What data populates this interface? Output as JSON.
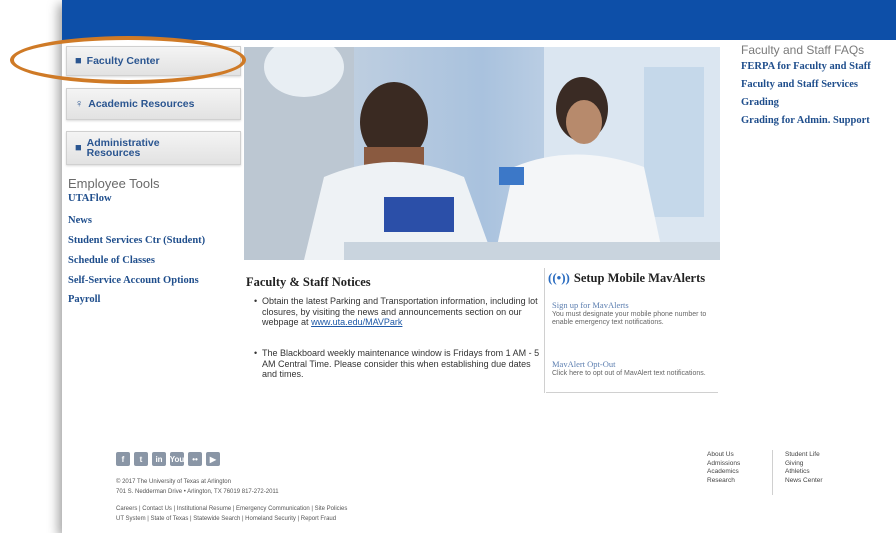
{
  "sidebar": {
    "nav": [
      {
        "label": "Faculty Center",
        "icon": "briefcase-icon"
      },
      {
        "label": "Academic Resources",
        "icon": "lightbulb-icon"
      },
      {
        "label": "Administrative Resources",
        "icon": "book-icon"
      }
    ],
    "tools_title": "Employee Tools",
    "tools": [
      "UTAFlow",
      "News",
      "Student Services Ctr (Student)",
      "Schedule of Classes",
      "Self-Service Account Options",
      "Payroll"
    ]
  },
  "faq": {
    "title": "Faculty and Staff FAQs",
    "links": [
      "FERPA for Faculty and Staff",
      "Faculty and Staff Services",
      "Grading",
      "Grading for Admin. Support"
    ]
  },
  "notices": {
    "title": "Faculty & Staff Notices",
    "item1_text": "Obtain the latest Parking and Transportation information, including lot closures, by visiting the news and announcements section on our webpage at",
    "item1_link": "www.uta.edu/MAVPark",
    "item2_text": "The Blackboard weekly maintenance window is Fridays from 1 AM - 5 AM Central Time. Please consider this when establishing due dates and times."
  },
  "mavalerts": {
    "title": "Setup Mobile MavAlerts",
    "signup_title": "Sign up for MavAlerts",
    "signup_text": "You must designate your mobile phone number to enable emergency text notifications.",
    "optout_title": "MavAlert Opt-Out",
    "optout_text": "Click here to opt out of MavAlert text notifications."
  },
  "footer": {
    "copyright": "© 2017 The University of Texas at Arlington",
    "address": "701 S. Nedderman Drive • Arlington, TX 76019 817-272-2011",
    "links_line1": "Careers | Contact Us | Institutional Resume | Emergency Communication | Site Policies",
    "links_line2": "UT System | State of Texas | Statewide Search | Homeland Security | Report Fraud",
    "col1": [
      "About Us",
      "Admissions",
      "Academics",
      "Research"
    ],
    "col2": [
      "Student Life",
      "Giving",
      "Athletics",
      "News Center"
    ],
    "social": [
      "f",
      "t",
      "in",
      "You",
      "••",
      "▶"
    ]
  },
  "colors": {
    "topbar": "#0d4fa8",
    "link": "#1f4e8c",
    "highlight": "#cf7a26"
  }
}
